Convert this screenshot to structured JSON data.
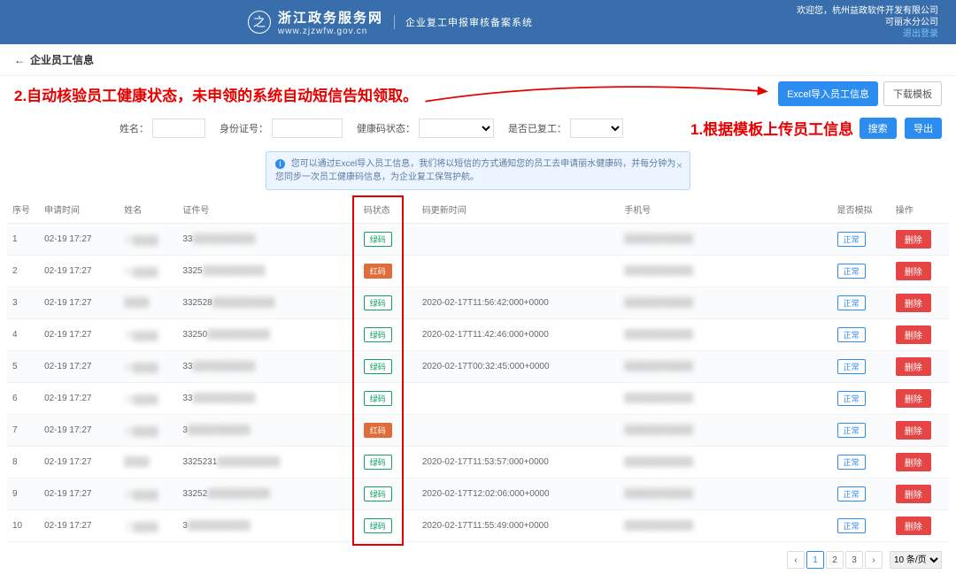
{
  "header": {
    "logo_title": "浙江政务服务网",
    "logo_url": "www.zjzwfw.gov.cn",
    "system_name": "企业复工申报审核备案系统",
    "greeting": "欢迎您，杭州益政软件开发有限公司",
    "branch": "可丽水分公司",
    "logout": "退出登录"
  },
  "breadcrumb": {
    "arrow": "←",
    "title": "企业员工信息"
  },
  "annotations": {
    "a2": "2.自动核验员工健康状态，未申领的系统自动短信告知领取。",
    "a1": "1.根据模板上传员工信息"
  },
  "buttons": {
    "upload": "Excel导入员工信息",
    "download": "下载模板",
    "search": "搜索",
    "export": "导出"
  },
  "filters": {
    "name_label": "姓名：",
    "id_label": "身份证号：",
    "code_label": "健康码状态：",
    "return_label": "是否已复工："
  },
  "alert": {
    "text": "您可以通过Excel导入员工信息，我们将以短信的方式通知您的员工去申请丽水健康码，并每分钟为您同步一次员工健康码信息，为企业复工保驾护航。"
  },
  "table": {
    "headers": {
      "idx": "序号",
      "time": "申请时间",
      "name": "姓名",
      "cert": "证件号",
      "code": "码状态",
      "update": "码更新时间",
      "phone": "手机号",
      "normal": "是否模拟",
      "op": "操作"
    },
    "badge_green": "绿码",
    "badge_red": "红码",
    "normal_text": "正常",
    "delete_text": "删除",
    "rows": [
      {
        "idx": "1",
        "time": "02-19 17:27",
        "name": "吴",
        "cert": "33",
        "code": "green",
        "update": "",
        "phone": ""
      },
      {
        "idx": "2",
        "time": "02-19 17:27",
        "name": "陈",
        "cert": "3325",
        "code": "red",
        "update": "",
        "phone": ""
      },
      {
        "idx": "3",
        "time": "02-19 17:27",
        "name": "",
        "cert": "332528",
        "code": "green",
        "update": "2020-02-17T11:56:42:000+0000",
        "phone": ""
      },
      {
        "idx": "4",
        "time": "02-19 17:27",
        "name": "李",
        "cert": "33250",
        "code": "green",
        "update": "2020-02-17T11:42:46:000+0000",
        "phone": ""
      },
      {
        "idx": "5",
        "time": "02-19 17:27",
        "name": "前",
        "cert": "33",
        "code": "green",
        "update": "2020-02-17T00:32:45:000+0000",
        "phone": ""
      },
      {
        "idx": "6",
        "time": "02-19 17:27",
        "name": "吴",
        "cert": "33",
        "code": "green",
        "update": "",
        "phone": ""
      },
      {
        "idx": "7",
        "time": "02-19 17:27",
        "name": "成",
        "cert": "3",
        "code": "red",
        "update": "",
        "phone": ""
      },
      {
        "idx": "8",
        "time": "02-19 17:27",
        "name": "",
        "cert": "3325231",
        "code": "green",
        "update": "2020-02-17T11:53:57:000+0000",
        "phone": ""
      },
      {
        "idx": "9",
        "time": "02-19 17:27",
        "name": "吴",
        "cert": "33252",
        "code": "green",
        "update": "2020-02-17T12:02:06:000+0000",
        "phone": ""
      },
      {
        "idx": "10",
        "time": "02-19 17:27",
        "name": "王",
        "cert": "3",
        "code": "green",
        "update": "2020-02-17T11:55:49:000+0000",
        "phone": ""
      }
    ]
  },
  "pager": {
    "prev": "‹",
    "p1": "1",
    "p2": "2",
    "p3": "3",
    "next": "›",
    "size": "10 条/页"
  }
}
